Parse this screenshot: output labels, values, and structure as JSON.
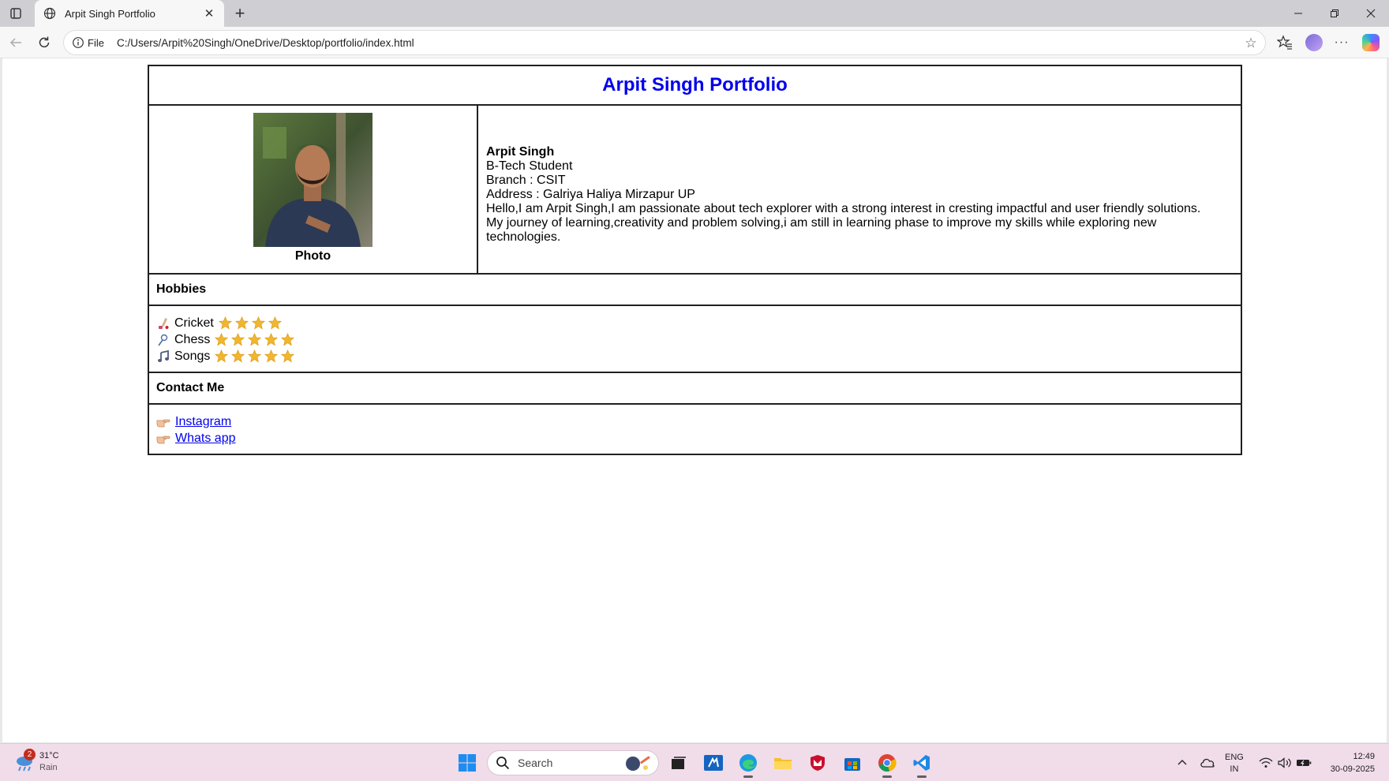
{
  "browser": {
    "tab_title": "Arpit Singh Portfolio",
    "address_scheme_label": "File",
    "url": "C:/Users/Arpit%20Singh/OneDrive/Desktop/portfolio/index.html"
  },
  "portfolio": {
    "heading": "Arpit Singh Portfolio",
    "photo_caption": "Photo",
    "profile": {
      "name": "Arpit Singh",
      "role": "B-Tech Student",
      "branch": "Branch : CSIT",
      "address": "Address : Galriya Haliya Mirzapur UP",
      "bio_line1": "Hello,I am Arpit Singh,I am passionate about tech explorer with a strong interest in cresting impactful and user friendly solutions.",
      "bio_line2": "My journey of learning,creativity and problem solving,i am still in learning phase to improve my skills while exploring new technologies."
    },
    "hobbies_heading": "Hobbies",
    "hobbies": [
      {
        "icon": "cricket-bat-icon",
        "label": "Cricket",
        "rating": 4,
        "max_rating": 4
      },
      {
        "icon": "chess-pawn-icon",
        "label": "Chess",
        "rating": 5,
        "max_rating": 5
      },
      {
        "icon": "music-note-icon",
        "label": "Songs",
        "rating": 5,
        "max_rating": 5
      }
    ],
    "contact_heading": "Contact Me",
    "contacts": [
      {
        "icon": "pointing-hand-icon",
        "label": "Instagram"
      },
      {
        "icon": "pointing-hand-icon",
        "label": "Whats app"
      }
    ],
    "colors": {
      "heading": "#0000ee",
      "link": "#0000ee",
      "star": "#f2b62e"
    }
  },
  "taskbar": {
    "weather": {
      "temp": "31°C",
      "condition": "Rain",
      "badge": "2"
    },
    "search_placeholder": "Search",
    "language": {
      "line1": "ENG",
      "line2": "IN"
    },
    "clock": {
      "time": "12:49",
      "date": "30-09-2025"
    }
  }
}
